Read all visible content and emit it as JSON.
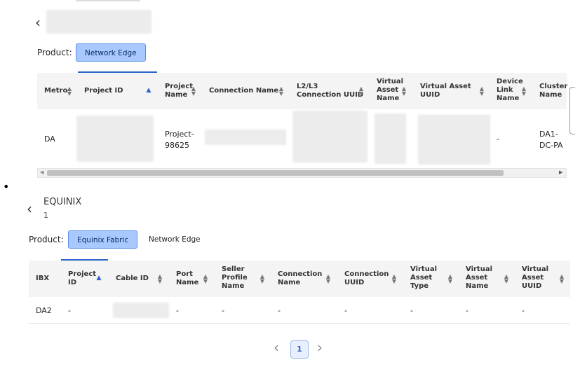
{
  "top": {
    "product_label": "Product:",
    "product_pills": [
      {
        "label": "Network Edge",
        "active": true
      }
    ],
    "columns": [
      "Metro",
      "Project ID",
      "Project\nName",
      "Connection Name",
      "L2/L3\nConnection UUID",
      "Virtual\nAsset\nName",
      "Virtual Asset\nUUID",
      "Device\nLink\nName",
      "Cluster\nName"
    ],
    "row": {
      "metro": "DA",
      "project_name": "Project-\n98625",
      "device_link_name": "-",
      "cluster_name": "DA1-\nDC-PA"
    }
  },
  "bullet": "•",
  "bottom": {
    "org_name": "EQUINIX",
    "org_sub": "1",
    "product_label": "Product:",
    "product_pills": [
      {
        "label": "Equinix Fabric",
        "active": true
      },
      {
        "label": "Network Edge",
        "active": false
      }
    ],
    "columns": [
      "IBX",
      "Project\nID",
      "Cable ID",
      "Port\nName",
      "Seller\nProfile\nName",
      "Connection\nName",
      "Connection\nUUID",
      "Virtual\nAsset\nType",
      "Virtual\nAsset\nName",
      "Virtual\nAsset\nUUID"
    ],
    "row": {
      "ibx": "DA2",
      "project_id": "-",
      "port_name": "-",
      "seller_profile": "-",
      "connection_name": "-",
      "connection_uuid": "-",
      "va_type": "-",
      "va_name": "-",
      "va_uuid": "-"
    }
  },
  "pagination": {
    "current": "1",
    "prev_icon": "chevron-left-icon",
    "next_icon": "chevron-right-icon"
  },
  "colors": {
    "accent": "#2b63c9",
    "pill_active_bg": "#a9c8ff",
    "pill_active_border": "#5c8fe6"
  }
}
